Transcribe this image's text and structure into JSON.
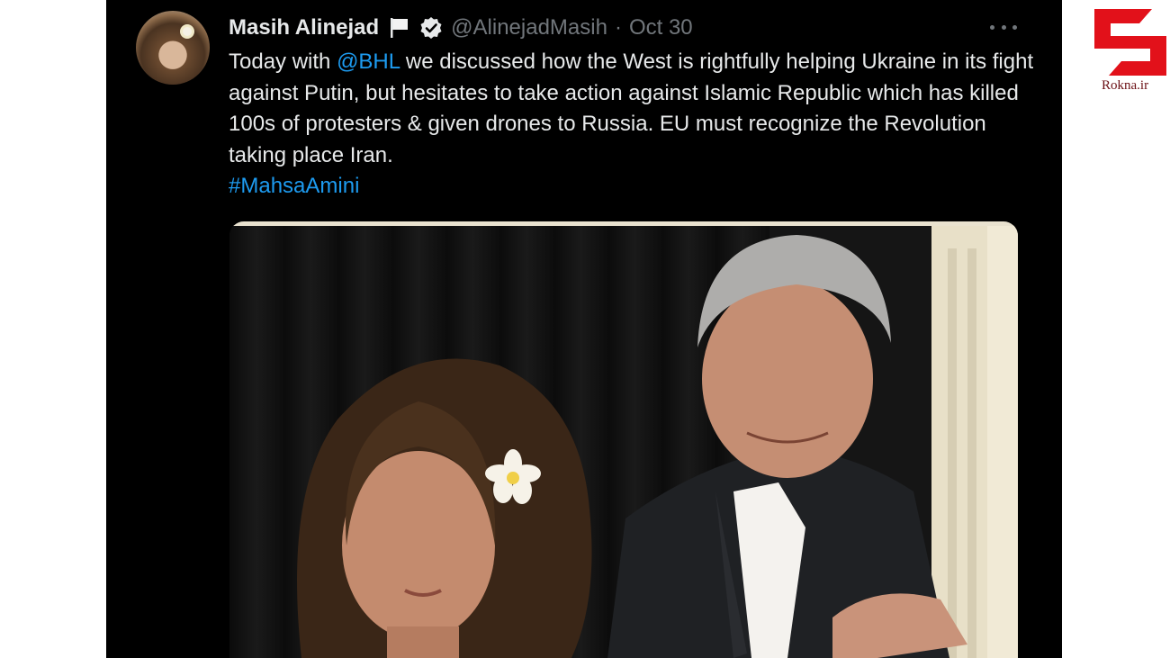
{
  "tweet": {
    "author_name": "Masih Alinejad",
    "handle": "@AlinejadMasih",
    "separator": "·",
    "date": "Oct 30",
    "text_before_mention": "Today with ",
    "mention": "@BHL",
    "text_after_mention": " we discussed how the West is rightfully helping Ukraine in its fight against Putin, but hesitates to take action against Islamic Republic which has killed 100s of protesters & given drones to Russia. EU must recognize the Revolution taking place Iran.",
    "hashtag": "#MahsaAmini",
    "icons": [
      "flag-icon",
      "verified-icon",
      "more-options-icon"
    ]
  },
  "watermark": {
    "site": "Rokna.ir",
    "brand_color": "#e2111a"
  },
  "colors": {
    "background": "#000000",
    "text": "#e7e9ea",
    "secondary": "#71767b",
    "link": "#1d9bf0"
  }
}
